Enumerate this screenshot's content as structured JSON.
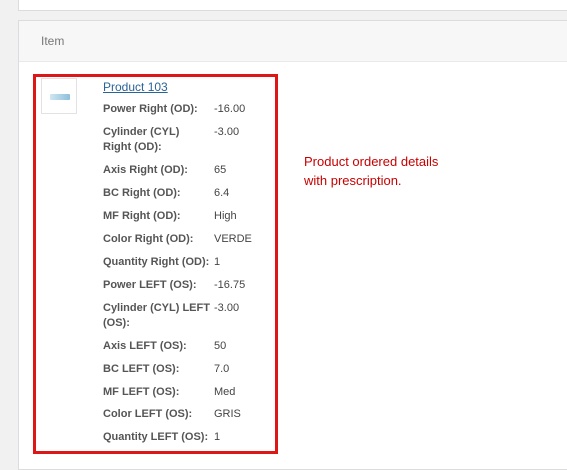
{
  "panel": {
    "header_label": "Item"
  },
  "product": {
    "link_text": "Product 103",
    "meta": [
      {
        "label": "Power Right (OD):",
        "value": "-16.00"
      },
      {
        "label": "Cylinder (CYL) Right (OD):",
        "value": "-3.00"
      },
      {
        "label": "Axis Right (OD):",
        "value": "65"
      },
      {
        "label": "BC Right (OD):",
        "value": "6.4"
      },
      {
        "label": "MF Right (OD):",
        "value": "High"
      },
      {
        "label": "Color Right (OD):",
        "value": "VERDE"
      },
      {
        "label": "Quantity Right (OD):",
        "value": "1"
      },
      {
        "label": "Power LEFT (OS):",
        "value": "-16.75"
      },
      {
        "label": "Cylinder (CYL) LEFT (OS):",
        "value": "-3.00"
      },
      {
        "label": "Axis LEFT (OS):",
        "value": "50"
      },
      {
        "label": "BC LEFT (OS):",
        "value": "7.0"
      },
      {
        "label": "MF LEFT (OS):",
        "value": "Med"
      },
      {
        "label": "Color LEFT (OS):",
        "value": "GRIS"
      },
      {
        "label": "Quantity LEFT (OS):",
        "value": "1"
      }
    ]
  },
  "annotation": {
    "line1": "Product ordered details",
    "line2": "with prescription."
  },
  "colors": {
    "highlight": "#dd1616",
    "annotation": "#c80000",
    "link": "#2a6496"
  }
}
